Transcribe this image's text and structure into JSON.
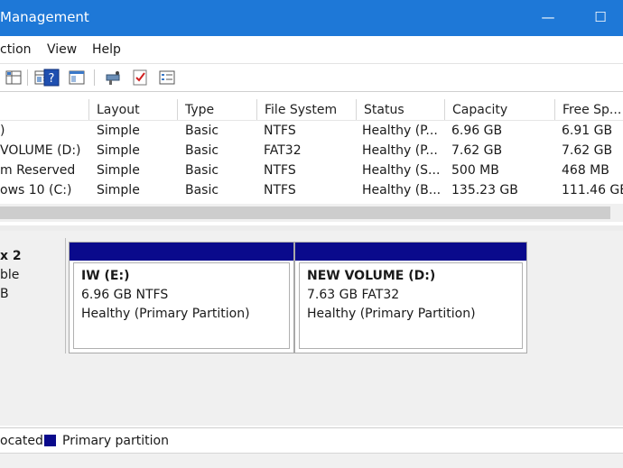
{
  "window": {
    "title": "Management",
    "minimize_glyph": "—",
    "maximize_glyph": "☐"
  },
  "menu": {
    "items": [
      {
        "label": "ction"
      },
      {
        "label": "View"
      },
      {
        "label": "Help"
      }
    ]
  },
  "toolbar": {
    "icons": [
      "grid-icon",
      "properties-icon",
      "help-icon",
      "console-icon",
      "connect-icon",
      "checklist-icon",
      "list-view-icon"
    ]
  },
  "volume_list": {
    "columns": [
      {
        "label": ""
      },
      {
        "label": "Layout"
      },
      {
        "label": "Type"
      },
      {
        "label": "File System"
      },
      {
        "label": "Status"
      },
      {
        "label": "Capacity"
      },
      {
        "label": "Free Sp..."
      }
    ],
    "rows": [
      {
        "volume": ")",
        "layout": "Simple",
        "type": "Basic",
        "fs": "NTFS",
        "status": "Healthy (P...",
        "capacity": "6.96 GB",
        "free": "6.91 GB"
      },
      {
        "volume": "VOLUME (D:)",
        "layout": "Simple",
        "type": "Basic",
        "fs": "FAT32",
        "status": "Healthy (P...",
        "capacity": "7.62 GB",
        "free": "7.62 GB"
      },
      {
        "volume": "m Reserved",
        "layout": "Simple",
        "type": "Basic",
        "fs": "NTFS",
        "status": "Healthy (S...",
        "capacity": "500 MB",
        "free": "468 MB"
      },
      {
        "volume": "ows 10 (C:)",
        "layout": "Simple",
        "type": "Basic",
        "fs": "NTFS",
        "status": "Healthy (B...",
        "capacity": "135.23 GB",
        "free": "111.46 GB"
      }
    ]
  },
  "disk": {
    "name": "x 2",
    "type": "ble",
    "size": "B",
    "partitions": [
      {
        "label": "IW  (E:)",
        "size_fs": "6.96 GB NTFS",
        "status": "Healthy (Primary Partition)"
      },
      {
        "label": "NEW VOLUME  (D:)",
        "size_fs": "7.63 GB FAT32",
        "status": "Healthy (Primary Partition)"
      }
    ]
  },
  "legend": {
    "unallocated": "ocated",
    "primary": "Primary partition",
    "primary_color": "#0a0a8c"
  },
  "colors": {
    "titlebar": "#1e78d7",
    "partition_header": "#0a0a8c"
  }
}
